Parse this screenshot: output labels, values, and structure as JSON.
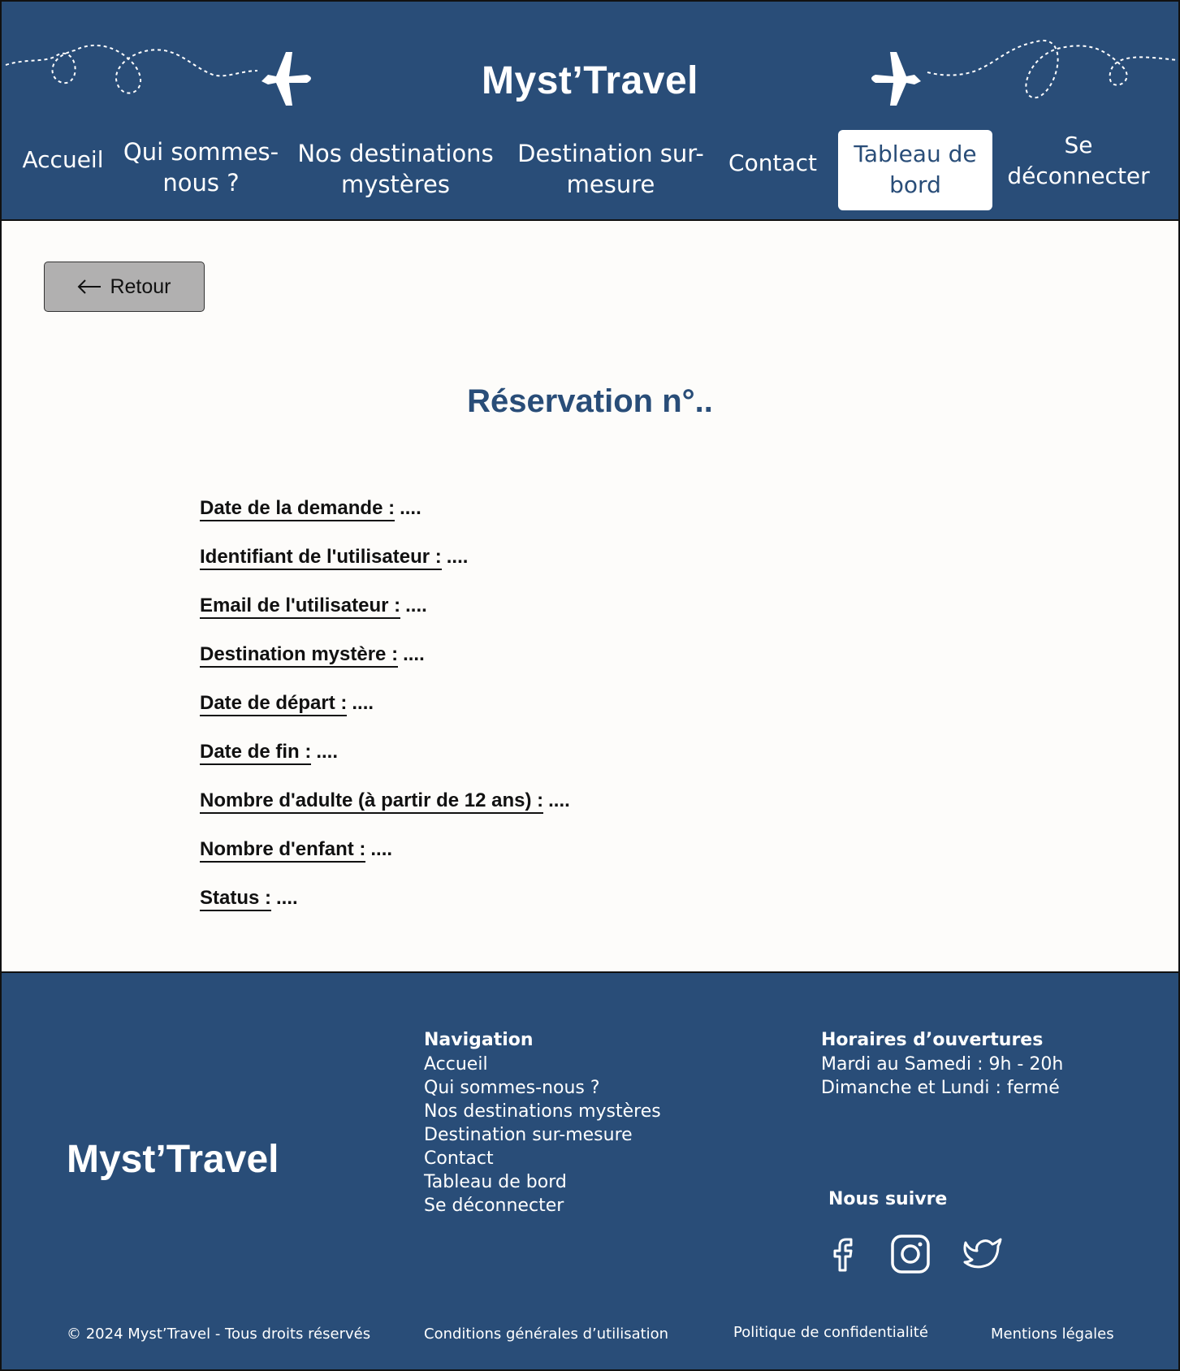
{
  "header": {
    "brand": "Myst’Travel",
    "nav": [
      {
        "label": "Accueil"
      },
      {
        "label": "Qui sommes-nous ?"
      },
      {
        "label": "Nos destinations mystères"
      },
      {
        "label": "Destination sur-mesure"
      },
      {
        "label": "Contact"
      },
      {
        "label": "Tableau de bord",
        "active": true
      },
      {
        "label": "Se déconnecter"
      }
    ]
  },
  "main": {
    "back_label": "Retour",
    "title": "Réservation n°..",
    "fields": [
      {
        "label": "Date de la demande :",
        "value": "...."
      },
      {
        "label": "Identifiant de l'utilisateur :",
        "value": "...."
      },
      {
        "label": "Email de l'utilisateur :",
        "value": "...."
      },
      {
        "label": "Destination mystère :",
        "value": "...."
      },
      {
        "label": "Date de départ :",
        "value": "...."
      },
      {
        "label": "Date de fin :",
        "value": "...."
      },
      {
        "label": "Nombre d'adulte (à partir de 12 ans) :",
        "value": "...."
      },
      {
        "label": "Nombre d'enfant :",
        "value": "...."
      },
      {
        "label": "Status :",
        "value": "...."
      }
    ]
  },
  "footer": {
    "brand": "Myst’Travel",
    "navigation_title": "Navigation",
    "navigation_links": [
      "Accueil",
      "Qui sommes-nous ?",
      "Nos destinations mystères",
      "Destination sur-mesure",
      "Contact",
      "Tableau de bord",
      "Se déconnecter"
    ],
    "hours_title": "Horaires d’ouvertures",
    "hours_lines": [
      "Mardi au Samedi : 9h - 20h",
      "Dimanche et Lundi : fermé"
    ],
    "follow_title": "Nous suivre",
    "social_icons": [
      "facebook-icon",
      "instagram-icon",
      "twitter-icon"
    ],
    "copyright": "© 2024 Myst’Travel - Tous droits réservés",
    "terms": "Conditions générales d’utilisation",
    "privacy": "Politique de confidentialité",
    "legal": "Mentions légales"
  },
  "colors": {
    "primary": "#294d78",
    "background": "#fdfcfa",
    "button_grey": "#b1b0b0"
  }
}
